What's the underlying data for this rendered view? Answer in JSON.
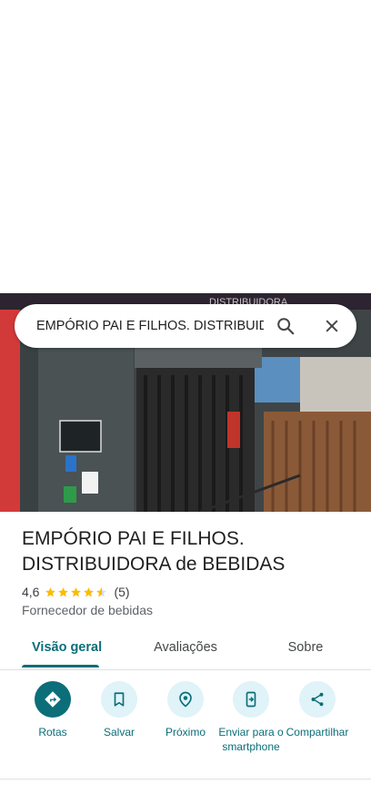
{
  "search": {
    "query": "EMPÓRIO PAI E FILHOS. DISTRIBUIDORA de BEBIDAS"
  },
  "photo": {
    "sign_text": "DISTRIBUIDORA",
    "icon": "storefront-photo"
  },
  "place": {
    "title": "EMPÓRIO PAI E FILHOS. DISTRIBUIDORA de BEBIDAS",
    "rating": "4,6",
    "rating_value": 4.6,
    "review_count": "(5)",
    "category": "Fornecedor de bebidas"
  },
  "tabs": [
    {
      "label": "Visão geral",
      "active": true
    },
    {
      "label": "Avaliações",
      "active": false
    },
    {
      "label": "Sobre",
      "active": false
    }
  ],
  "actions": [
    {
      "label": "Rotas",
      "icon": "directions-icon"
    },
    {
      "label": "Salvar",
      "icon": "bookmark-icon"
    },
    {
      "label": "Próximo",
      "icon": "nearby-icon"
    },
    {
      "label": "Enviar para o smartphone",
      "icon": "send-to-phone-icon"
    },
    {
      "label": "Compartilhar",
      "icon": "share-icon"
    }
  ],
  "colors": {
    "accent": "#0b6e79",
    "action_bg": "#dff3f8",
    "star": "#fbbc04"
  }
}
